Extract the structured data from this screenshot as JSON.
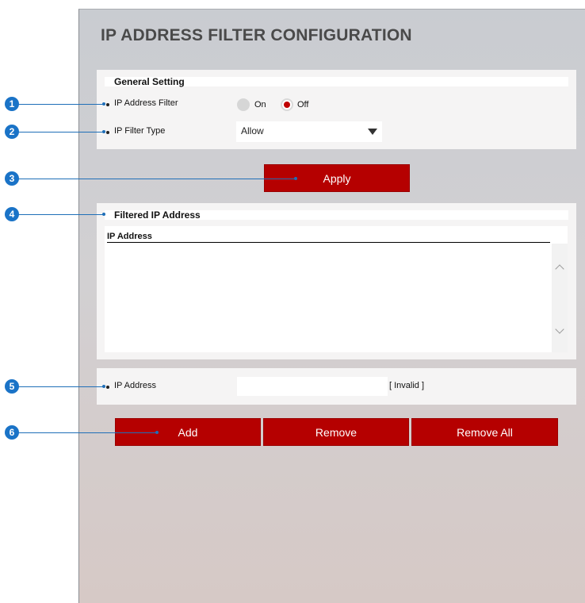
{
  "page": {
    "title": "IP ADDRESS FILTER CONFIGURATION"
  },
  "general": {
    "heading": "General Setting",
    "filter_label": "IP Address Filter",
    "on_label": "On",
    "off_label": "Off",
    "selected": "Off",
    "type_label": "IP Filter Type",
    "type_value": "Allow"
  },
  "apply_label": "Apply",
  "filtered": {
    "heading": "Filtered IP Address",
    "column": "IP Address",
    "rows": []
  },
  "address": {
    "label": "IP Address",
    "value": "",
    "status": "[ Invalid ]"
  },
  "actions": {
    "add": "Add",
    "remove": "Remove",
    "remove_all": "Remove All"
  },
  "callouts": [
    "1",
    "2",
    "3",
    "4",
    "5",
    "6"
  ],
  "colors": {
    "accent": "#b50000",
    "callout": "#1a73c7"
  }
}
